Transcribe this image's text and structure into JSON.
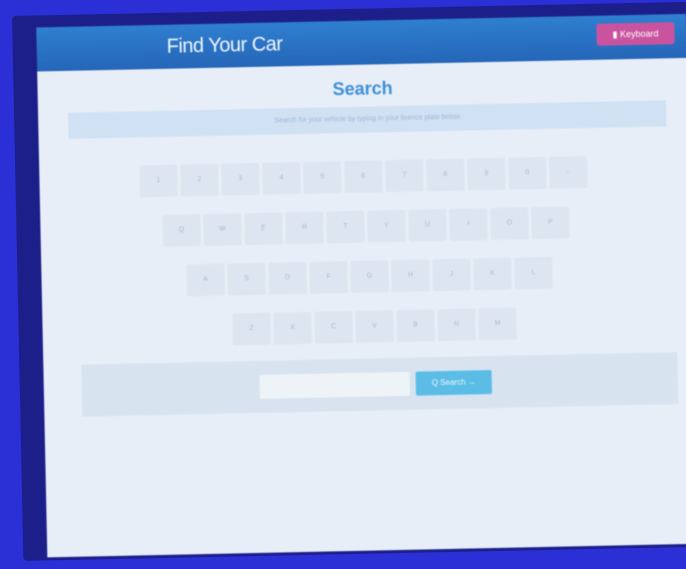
{
  "header": {
    "app_title": "Find Your Car",
    "top_button_label": "▮ Keyboard"
  },
  "main": {
    "heading": "Search",
    "hint": "Search for your vehicle by typing in your licence plate below"
  },
  "keyboard": {
    "row1": [
      "1",
      "2",
      "3",
      "4",
      "5",
      "6",
      "7",
      "8",
      "9",
      "0",
      "←"
    ],
    "row2": [
      "Q",
      "W",
      "E",
      "R",
      "T",
      "Y",
      "U",
      "I",
      "O",
      "P"
    ],
    "row3": [
      "A",
      "S",
      "D",
      "F",
      "G",
      "H",
      "J",
      "K",
      "L"
    ],
    "row4": [
      "Z",
      "X",
      "C",
      "V",
      "B",
      "N",
      "M"
    ]
  },
  "search": {
    "input_value": "",
    "button_label": "Q Search →"
  },
  "colors": {
    "header": "#2566b8",
    "accent_button": "#c9539f",
    "search_button": "#5bbde6",
    "heading": "#3d8fd9"
  }
}
